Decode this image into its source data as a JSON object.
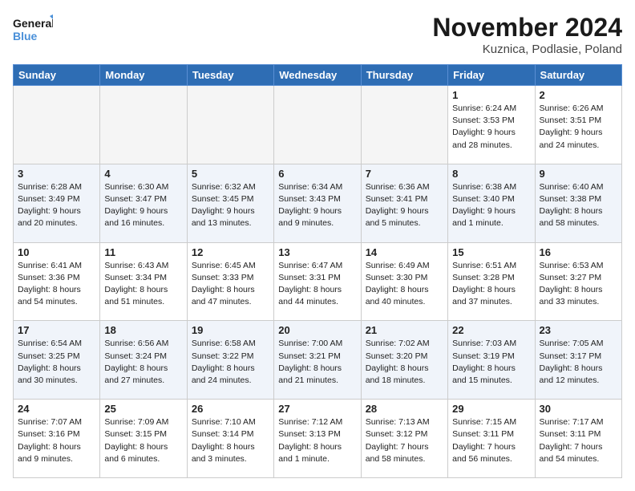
{
  "logo": {
    "text_general": "General",
    "text_blue": "Blue"
  },
  "header": {
    "month": "November 2024",
    "location": "Kuznica, Podlasie, Poland"
  },
  "days_of_week": [
    "Sunday",
    "Monday",
    "Tuesday",
    "Wednesday",
    "Thursday",
    "Friday",
    "Saturday"
  ],
  "weeks": [
    {
      "days": [
        {
          "num": "",
          "empty": true
        },
        {
          "num": "",
          "empty": true
        },
        {
          "num": "",
          "empty": true
        },
        {
          "num": "",
          "empty": true
        },
        {
          "num": "",
          "empty": true
        },
        {
          "num": "1",
          "sunrise": "6:24 AM",
          "sunset": "3:53 PM",
          "daylight": "9 hours and 28 minutes."
        },
        {
          "num": "2",
          "sunrise": "6:26 AM",
          "sunset": "3:51 PM",
          "daylight": "9 hours and 24 minutes."
        }
      ]
    },
    {
      "days": [
        {
          "num": "3",
          "sunrise": "6:28 AM",
          "sunset": "3:49 PM",
          "daylight": "9 hours and 20 minutes."
        },
        {
          "num": "4",
          "sunrise": "6:30 AM",
          "sunset": "3:47 PM",
          "daylight": "9 hours and 16 minutes."
        },
        {
          "num": "5",
          "sunrise": "6:32 AM",
          "sunset": "3:45 PM",
          "daylight": "9 hours and 13 minutes."
        },
        {
          "num": "6",
          "sunrise": "6:34 AM",
          "sunset": "3:43 PM",
          "daylight": "9 hours and 9 minutes."
        },
        {
          "num": "7",
          "sunrise": "6:36 AM",
          "sunset": "3:41 PM",
          "daylight": "9 hours and 5 minutes."
        },
        {
          "num": "8",
          "sunrise": "6:38 AM",
          "sunset": "3:40 PM",
          "daylight": "9 hours and 1 minute."
        },
        {
          "num": "9",
          "sunrise": "6:40 AM",
          "sunset": "3:38 PM",
          "daylight": "8 hours and 58 minutes."
        }
      ]
    },
    {
      "days": [
        {
          "num": "10",
          "sunrise": "6:41 AM",
          "sunset": "3:36 PM",
          "daylight": "8 hours and 54 minutes."
        },
        {
          "num": "11",
          "sunrise": "6:43 AM",
          "sunset": "3:34 PM",
          "daylight": "8 hours and 51 minutes."
        },
        {
          "num": "12",
          "sunrise": "6:45 AM",
          "sunset": "3:33 PM",
          "daylight": "8 hours and 47 minutes."
        },
        {
          "num": "13",
          "sunrise": "6:47 AM",
          "sunset": "3:31 PM",
          "daylight": "8 hours and 44 minutes."
        },
        {
          "num": "14",
          "sunrise": "6:49 AM",
          "sunset": "3:30 PM",
          "daylight": "8 hours and 40 minutes."
        },
        {
          "num": "15",
          "sunrise": "6:51 AM",
          "sunset": "3:28 PM",
          "daylight": "8 hours and 37 minutes."
        },
        {
          "num": "16",
          "sunrise": "6:53 AM",
          "sunset": "3:27 PM",
          "daylight": "8 hours and 33 minutes."
        }
      ]
    },
    {
      "days": [
        {
          "num": "17",
          "sunrise": "6:54 AM",
          "sunset": "3:25 PM",
          "daylight": "8 hours and 30 minutes."
        },
        {
          "num": "18",
          "sunrise": "6:56 AM",
          "sunset": "3:24 PM",
          "daylight": "8 hours and 27 minutes."
        },
        {
          "num": "19",
          "sunrise": "6:58 AM",
          "sunset": "3:22 PM",
          "daylight": "8 hours and 24 minutes."
        },
        {
          "num": "20",
          "sunrise": "7:00 AM",
          "sunset": "3:21 PM",
          "daylight": "8 hours and 21 minutes."
        },
        {
          "num": "21",
          "sunrise": "7:02 AM",
          "sunset": "3:20 PM",
          "daylight": "8 hours and 18 minutes."
        },
        {
          "num": "22",
          "sunrise": "7:03 AM",
          "sunset": "3:19 PM",
          "daylight": "8 hours and 15 minutes."
        },
        {
          "num": "23",
          "sunrise": "7:05 AM",
          "sunset": "3:17 PM",
          "daylight": "8 hours and 12 minutes."
        }
      ]
    },
    {
      "days": [
        {
          "num": "24",
          "sunrise": "7:07 AM",
          "sunset": "3:16 PM",
          "daylight": "8 hours and 9 minutes."
        },
        {
          "num": "25",
          "sunrise": "7:09 AM",
          "sunset": "3:15 PM",
          "daylight": "8 hours and 6 minutes."
        },
        {
          "num": "26",
          "sunrise": "7:10 AM",
          "sunset": "3:14 PM",
          "daylight": "8 hours and 3 minutes."
        },
        {
          "num": "27",
          "sunrise": "7:12 AM",
          "sunset": "3:13 PM",
          "daylight": "8 hours and 1 minute."
        },
        {
          "num": "28",
          "sunrise": "7:13 AM",
          "sunset": "3:12 PM",
          "daylight": "7 hours and 58 minutes."
        },
        {
          "num": "29",
          "sunrise": "7:15 AM",
          "sunset": "3:11 PM",
          "daylight": "7 hours and 56 minutes."
        },
        {
          "num": "30",
          "sunrise": "7:17 AM",
          "sunset": "3:11 PM",
          "daylight": "7 hours and 54 minutes."
        }
      ]
    }
  ],
  "labels": {
    "sunrise": "Sunrise:",
    "sunset": "Sunset:",
    "daylight": "Daylight:"
  }
}
